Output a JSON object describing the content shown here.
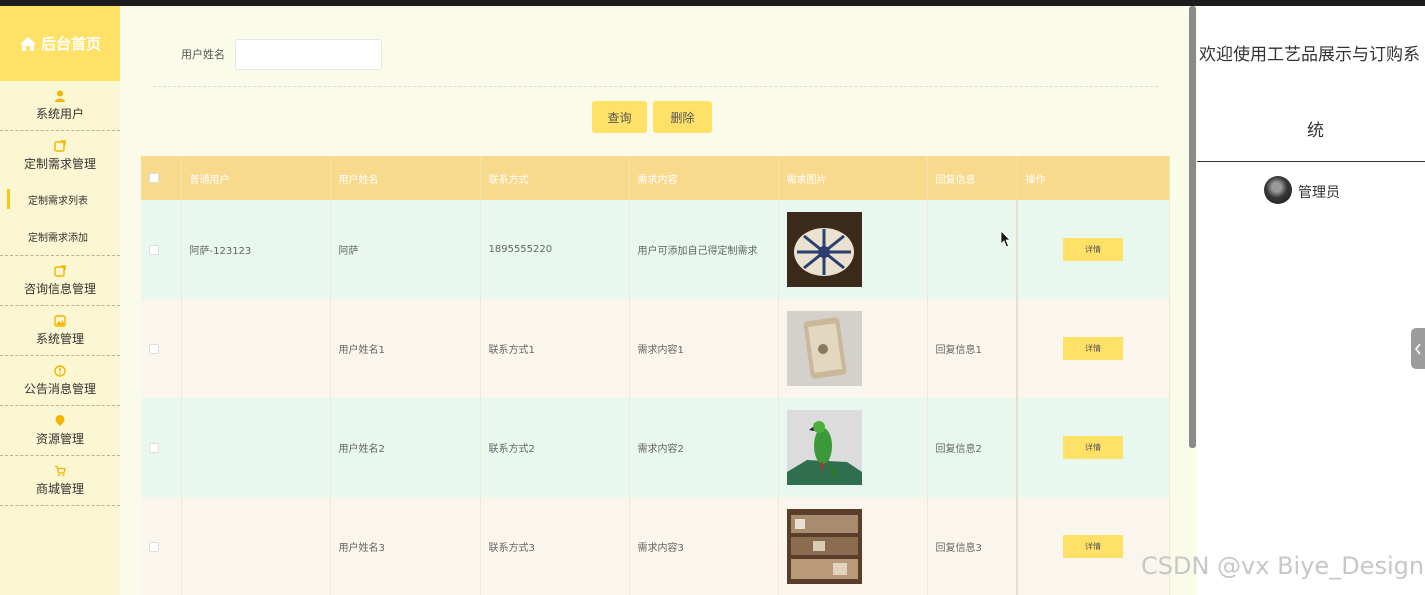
{
  "brand": {
    "title": "后台首页",
    "icon": "home-icon"
  },
  "sidebar": {
    "items": [
      {
        "label": "系统用户",
        "icon": "user-icon"
      },
      {
        "label": "定制需求管理",
        "icon": "edit-icon"
      },
      {
        "label": "咨询信息管理",
        "icon": "edit-icon"
      },
      {
        "label": "系统管理",
        "icon": "picture-icon"
      },
      {
        "label": "公告消息管理",
        "icon": "info-icon"
      },
      {
        "label": "资源管理",
        "icon": "location-icon"
      },
      {
        "label": "商城管理",
        "icon": "cart-icon"
      }
    ],
    "submenu": [
      {
        "label": "定制需求列表",
        "active": true
      },
      {
        "label": "定制需求添加",
        "active": false
      }
    ]
  },
  "search": {
    "label": "用户姓名",
    "value": ""
  },
  "buttons": {
    "query": "查询",
    "delete": "删除"
  },
  "table": {
    "headers": [
      "普通用户",
      "用户姓名",
      "联系方式",
      "需求内容",
      "需求图片",
      "回复信息",
      "操作"
    ],
    "rows": [
      {
        "user": "阿萨-123123",
        "name": "阿萨",
        "contact": "1895555220",
        "content": "用户可添加自己得定制需求",
        "image": "ceramic-knob-image",
        "reply": "",
        "action": "详情"
      },
      {
        "user": "",
        "name": "用户姓名1",
        "contact": "联系方式1",
        "content": "需求内容1",
        "image": "carved-box-image",
        "reply": "回复信息1",
        "action": "详情"
      },
      {
        "user": "",
        "name": "用户姓名2",
        "contact": "联系方式2",
        "content": "需求内容2",
        "image": "parrot-figurine-image",
        "reply": "回复信息2",
        "action": "详情"
      },
      {
        "user": "",
        "name": "用户姓名3",
        "contact": "联系方式3",
        "content": "需求内容3",
        "image": "shelf-display-image",
        "reply": "回复信息3",
        "action": "详情"
      }
    ]
  },
  "right_panel": {
    "welcome_line1": "欢迎使用工艺品展示与订购系",
    "welcome_line2": "统",
    "role": "管理员"
  },
  "watermark": "CSDN @vx Biye_Design",
  "colors": {
    "accent": "#ffe168",
    "header_row": "#f8da8c",
    "row_odd": "#e8f8ef",
    "row_even": "#fbf6ed",
    "sidebar_bg": "#fbf7d2"
  }
}
